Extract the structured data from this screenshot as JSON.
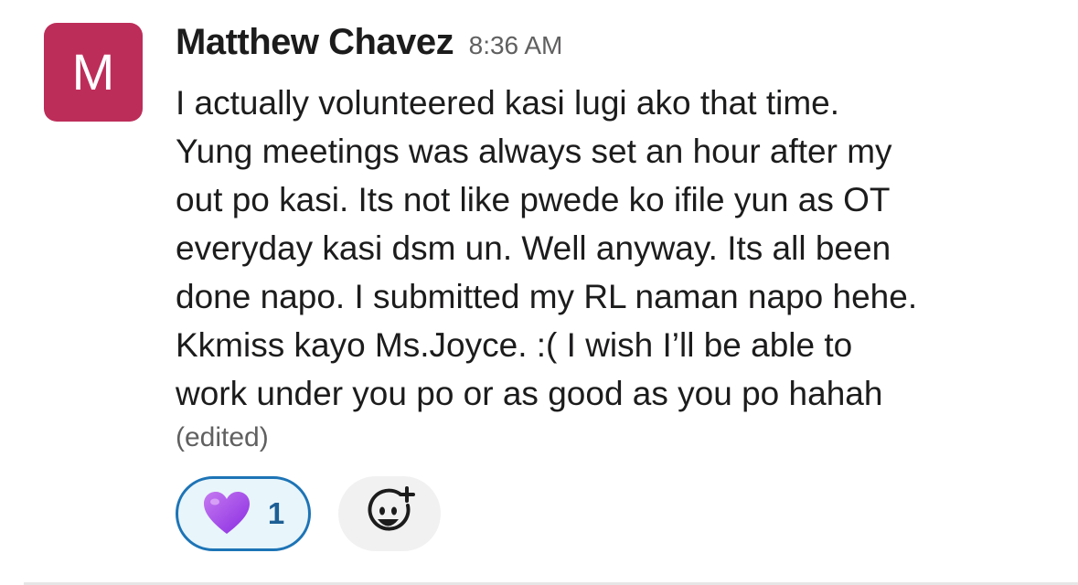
{
  "message": {
    "avatar_initial": "M",
    "author": "Matthew Chavez",
    "timestamp": "8:36 AM",
    "lines": [
      "I actually volunteered kasi lugi ako that time.",
      "Yung meetings was always set an hour after my",
      "out po kasi. Its not like pwede ko ifile yun as OT",
      "everyday kasi dsm un. Well anyway. Its all been",
      "done napo. I submitted my RL naman napo hehe.",
      "Kkmiss kayo Ms.Joyce. :( I wish I’ll be able to",
      "work under you po or as good as you po hahah"
    ],
    "edited_label": "(edited)",
    "avatar_color": "#bd2d5a"
  },
  "reactions": [
    {
      "icon": "purple-heart-icon",
      "count": "1",
      "selected": true
    }
  ],
  "add_reaction": {
    "icon": "add-reaction-icon"
  }
}
